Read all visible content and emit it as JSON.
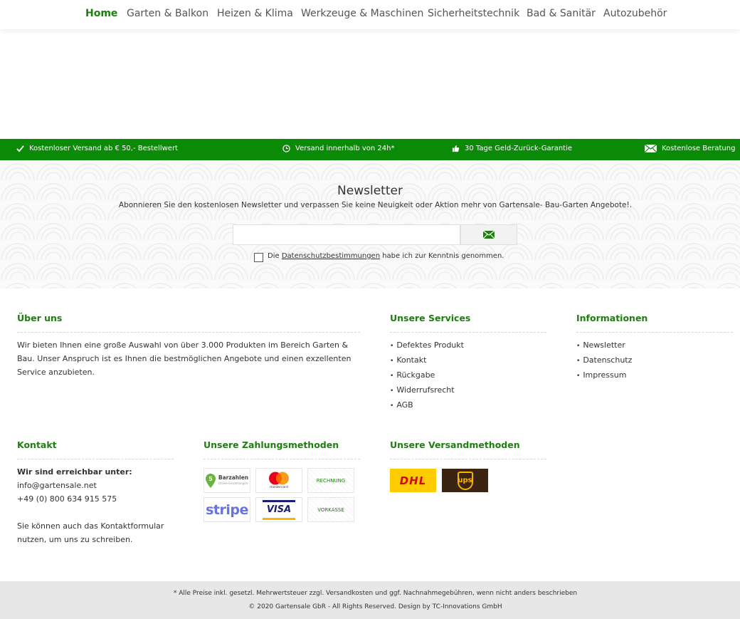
{
  "nav": {
    "items": [
      "Home",
      "Garten & Balkon",
      "Heizen & Klima",
      "Werkzeuge & Maschinen",
      "Sicherheitstechnik",
      "Bad & Sanitär",
      "Autozubehör"
    ]
  },
  "usp": {
    "shipping": "Kostenloser Versand ab € 50,- Bestellwert",
    "delivery": "Versand innerhalb von 24h*",
    "guarantee": "30 Tage Geld-Zurück-Garantie",
    "advice": "Kostenlose Beratung"
  },
  "newsletter": {
    "title": "Newsletter",
    "text": "Abonnieren Sie den kostenlosen Newsletter und verpassen Sie keine Neuigkeit oder Aktion mehr von Gartensale- Bau-Garten Angebote!.",
    "email_value": "",
    "consent_prefix": "Die",
    "consent_link": "Datenschutzbestimmungen",
    "consent_suffix": "habe ich zur Kenntnis genommen."
  },
  "footer": {
    "about": {
      "title": "Über uns",
      "text": "Wir bieten Ihnen eine große Auswahl von über 3.000 Produkten im Bereich Garten & Bau. Unser Anspruch ist es Ihnen die bestmöglichen Angebote und einen exzellenten Service anzubieten."
    },
    "services": {
      "title": "Unsere Services",
      "items": [
        "Defektes Produkt",
        "Kontakt",
        "Rückgabe",
        "Widerrufsrecht",
        "AGB"
      ]
    },
    "info": {
      "title": "Informationen",
      "items": [
        "Newsletter",
        "Datenschutz",
        "Impressum"
      ]
    },
    "contact": {
      "title": "Kontakt",
      "reach": "Wir sind erreichbar unter:",
      "email": "info@gartensale.net",
      "phone": "+49 (0) 800 634 915 575",
      "form_text": "Sie können auch das Kontaktformular nutzen, um uns zu schreiben."
    },
    "payment": {
      "title": "Unsere Zahlungsmethoden",
      "barzahlen": "Barzahlen",
      "barzahlen_sub": "Online-Einzahlungen",
      "mastercard": "mastercard",
      "rechnung": "RECHNUNG",
      "stripe": "stripe",
      "visa": "VISA",
      "vorkasse": "VORKASSE"
    },
    "shipping": {
      "title": "Unsere Versandmethoden",
      "dhl": "DHL",
      "ups": "ups"
    }
  },
  "bottom": {
    "line1": "* Alle Preise inkl. gesetzl. Mehrwertsteuer zzgl. Versandkosten und ggf. Nachnahmegebühren, wenn nicht anders beschrieben",
    "line2": "© 2020 Gartensale GbR - All Rights Reserved. Design by TC-Innovations GmbH"
  },
  "colors": {
    "brand_green": "#1f7d12",
    "usp_green": "#0a8a07",
    "bottom_bar": "#e7e7e7"
  },
  "icons": [
    "checkmark-icon",
    "clock-icon",
    "thumbs-up-icon",
    "envelope-icon",
    "send-envelope-icon"
  ]
}
